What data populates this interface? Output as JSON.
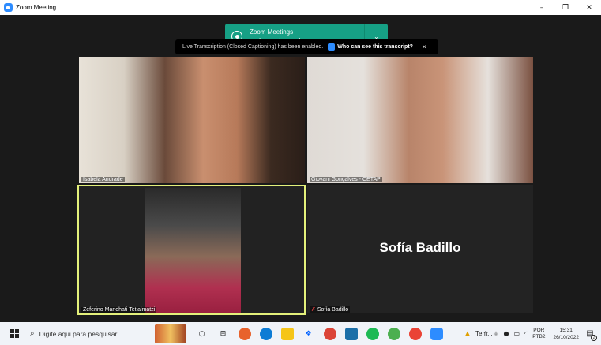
{
  "window": {
    "title": "Zoom Meeting",
    "controls": [
      "–",
      "❐",
      "✕"
    ]
  },
  "notification": {
    "line1": "Zoom Meetings",
    "line2": "está usando a webcam",
    "chevron": "⌄"
  },
  "banner": {
    "message": "Live Transcription (Closed Captioning) has been enabled.",
    "who": "Who can see this transcript?",
    "close": "×"
  },
  "participants": [
    {
      "name": "Isabela Andrade"
    },
    {
      "name": "Giovani Gonçalves - CETAP"
    },
    {
      "name": "Zeferino Manohati Tetlalmatzi"
    },
    {
      "name": "Sofía Badillo",
      "display": "Sofía Badillo"
    }
  ],
  "taskbar": {
    "search_placeholder": "Digite aqui para pesquisar",
    "tem_label": "Tem...",
    "lang_line1": "POR",
    "lang_line2": "PTB2",
    "time": "15:31",
    "date": "26/10/2022",
    "notif_count": "2",
    "colors": {
      "edge": "#0c7cd5",
      "spotify": "#1db954",
      "chrome": "#db4437",
      "zoom": "#2d8cff"
    }
  }
}
